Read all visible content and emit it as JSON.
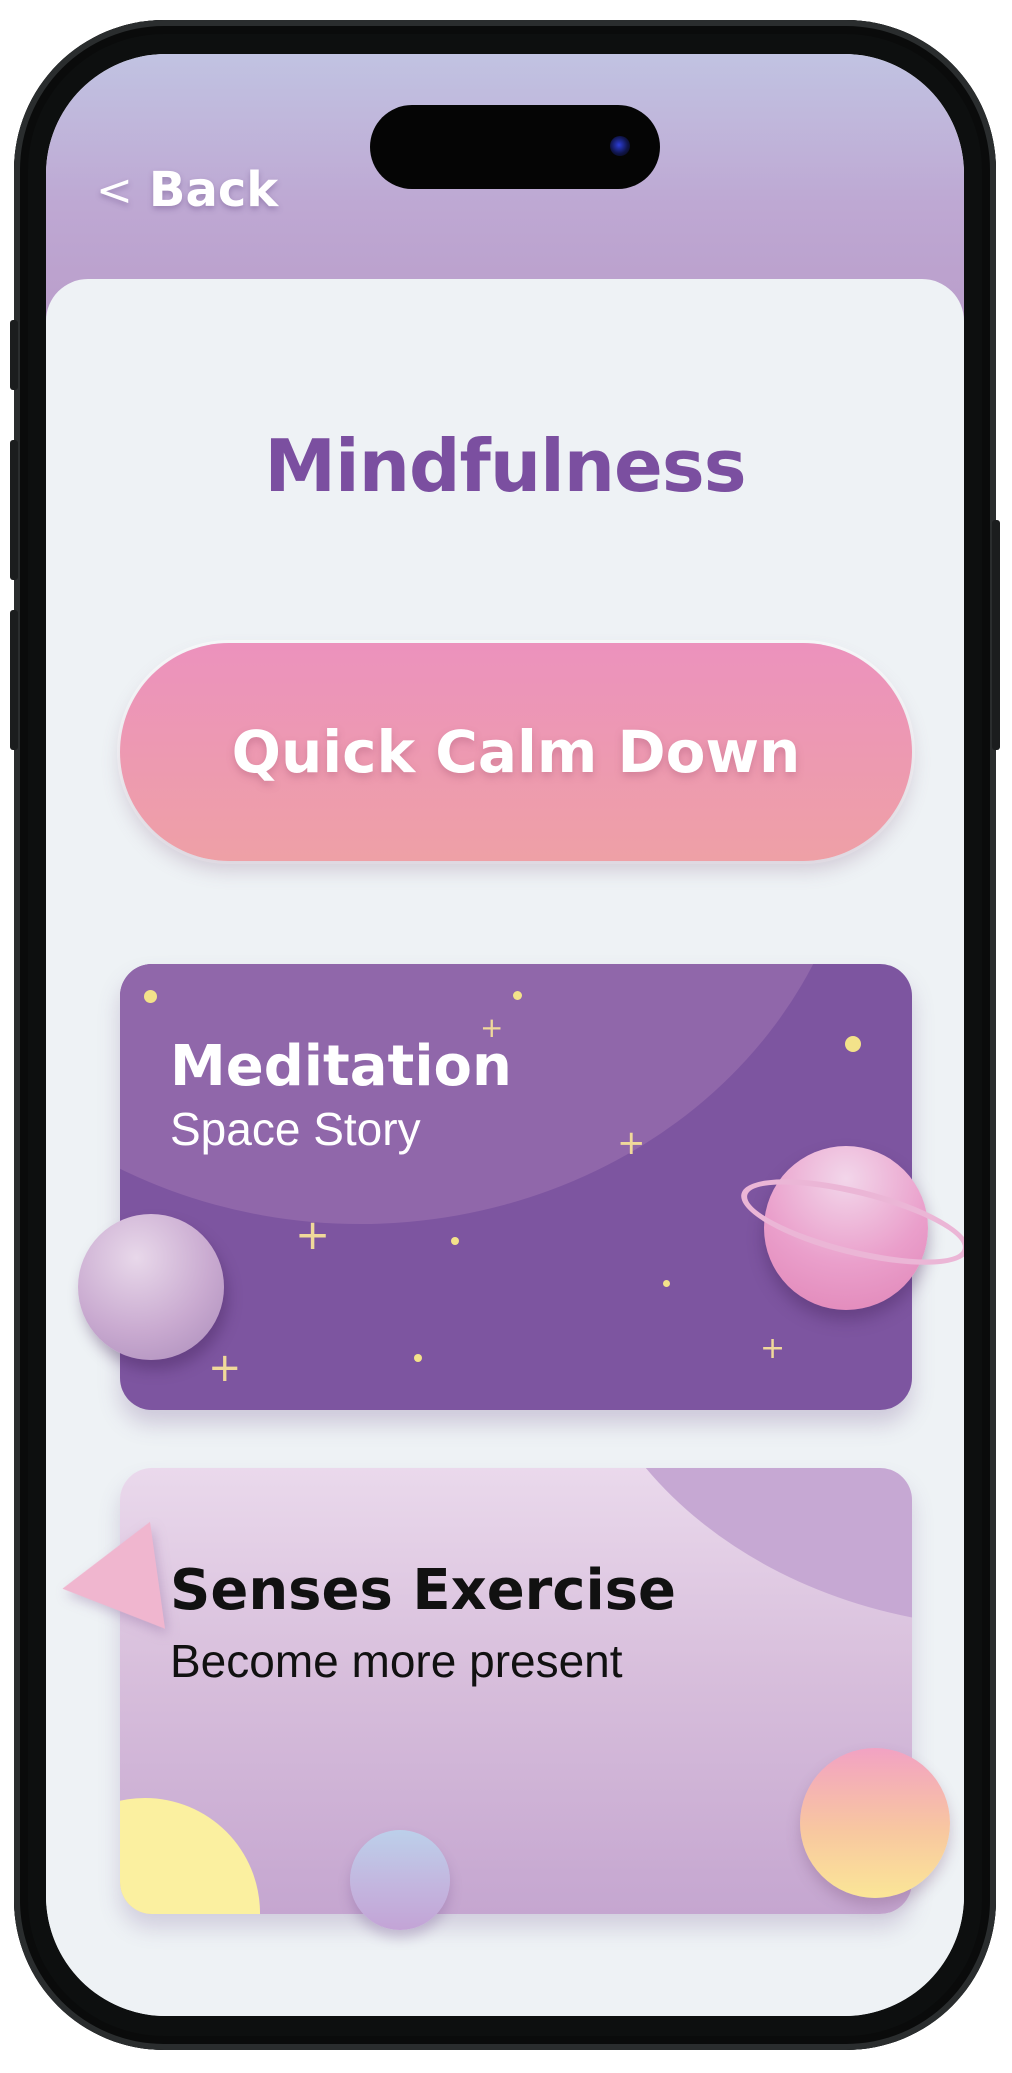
{
  "nav": {
    "back_label": "Back",
    "back_chevron": "<"
  },
  "page": {
    "title": "Mindfulness"
  },
  "actions": {
    "quick_calm_label": "Quick Calm Down"
  },
  "cards": {
    "meditation": {
      "title": "Meditation",
      "subtitle": "Space Story"
    },
    "senses": {
      "title": "Senses Exercise",
      "subtitle": "Become more present"
    }
  },
  "colors": {
    "title": "#7b4fa0",
    "header_top": "#c1c3e2",
    "header_bottom": "#b99bc8",
    "calm_pink": "#ec92bd",
    "meditation_purple": "#7d55a0",
    "background": "#eef2f5"
  }
}
